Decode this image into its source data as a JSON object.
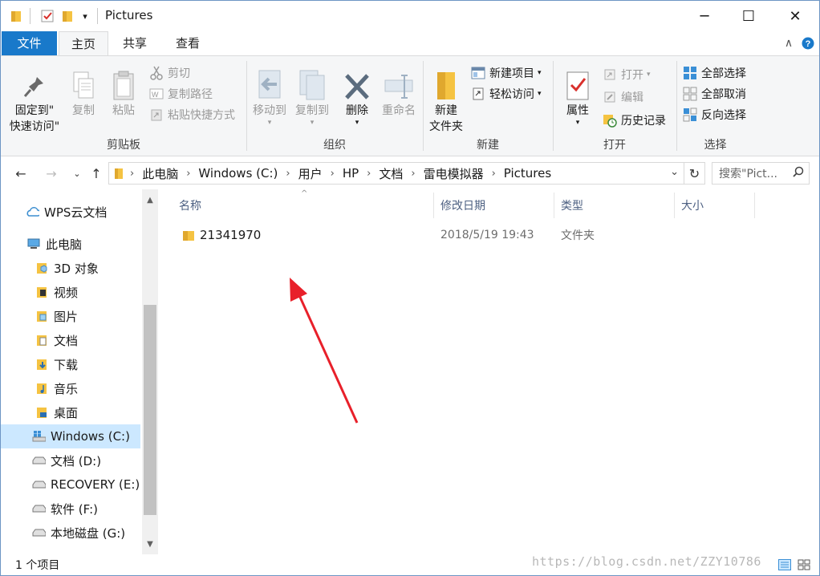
{
  "window": {
    "title": "Pictures",
    "controls": {
      "minimize": "─",
      "maximize": "☐",
      "close": "✕"
    }
  },
  "ribbon_tabs": {
    "file": "文件",
    "home": "主页",
    "share": "共享",
    "view": "查看"
  },
  "ribbon": {
    "clipboard": {
      "label": "剪贴板",
      "pin_line1": "固定到\"",
      "pin_line2": "快速访问\"",
      "copy": "复制",
      "paste": "粘贴",
      "cut": "剪切",
      "copy_path": "复制路径",
      "paste_shortcut": "粘贴快捷方式"
    },
    "organize": {
      "label": "组织",
      "move_to": "移动到",
      "copy_to": "复制到",
      "delete": "删除",
      "rename": "重命名"
    },
    "new": {
      "label": "新建",
      "new_folder_line1": "新建",
      "new_folder_line2": "文件夹",
      "new_item": "新建项目",
      "easy_access": "轻松访问"
    },
    "open": {
      "label": "打开",
      "properties": "属性",
      "open": "打开",
      "edit": "编辑",
      "history": "历史记录"
    },
    "select": {
      "label": "选择",
      "select_all": "全部选择",
      "select_none": "全部取消",
      "invert": "反向选择"
    }
  },
  "address": {
    "crumbs": [
      "此电脑",
      "Windows (C:)",
      "用户",
      "HP",
      "文档",
      "雷电模拟器",
      "Pictures"
    ],
    "search_placeholder": "搜索\"Pict..."
  },
  "nav": {
    "items": [
      {
        "label": "WPS云文档"
      },
      {
        "label": "此电脑"
      },
      {
        "label": "3D 对象"
      },
      {
        "label": "视频"
      },
      {
        "label": "图片"
      },
      {
        "label": "文档"
      },
      {
        "label": "下载"
      },
      {
        "label": "音乐"
      },
      {
        "label": "桌面"
      },
      {
        "label": "Windows (C:)"
      },
      {
        "label": "文档 (D:)"
      },
      {
        "label": "RECOVERY (E:)"
      },
      {
        "label": "软件 (F:)"
      },
      {
        "label": "本地磁盘 (G:)"
      }
    ]
  },
  "columns": {
    "name": "名称",
    "modified": "修改日期",
    "type": "类型",
    "size": "大小"
  },
  "files": [
    {
      "name": "21341970",
      "modified": "2018/5/19 19:43",
      "type": "文件夹",
      "size": ""
    }
  ],
  "status": {
    "count": "1 个项目"
  },
  "watermark": "https://blog.csdn.net/ZZY10786",
  "colors": {
    "accent": "#1979ca",
    "selection": "#cce8ff",
    "arrow": "#e8202a",
    "folder": "#f5c342"
  }
}
